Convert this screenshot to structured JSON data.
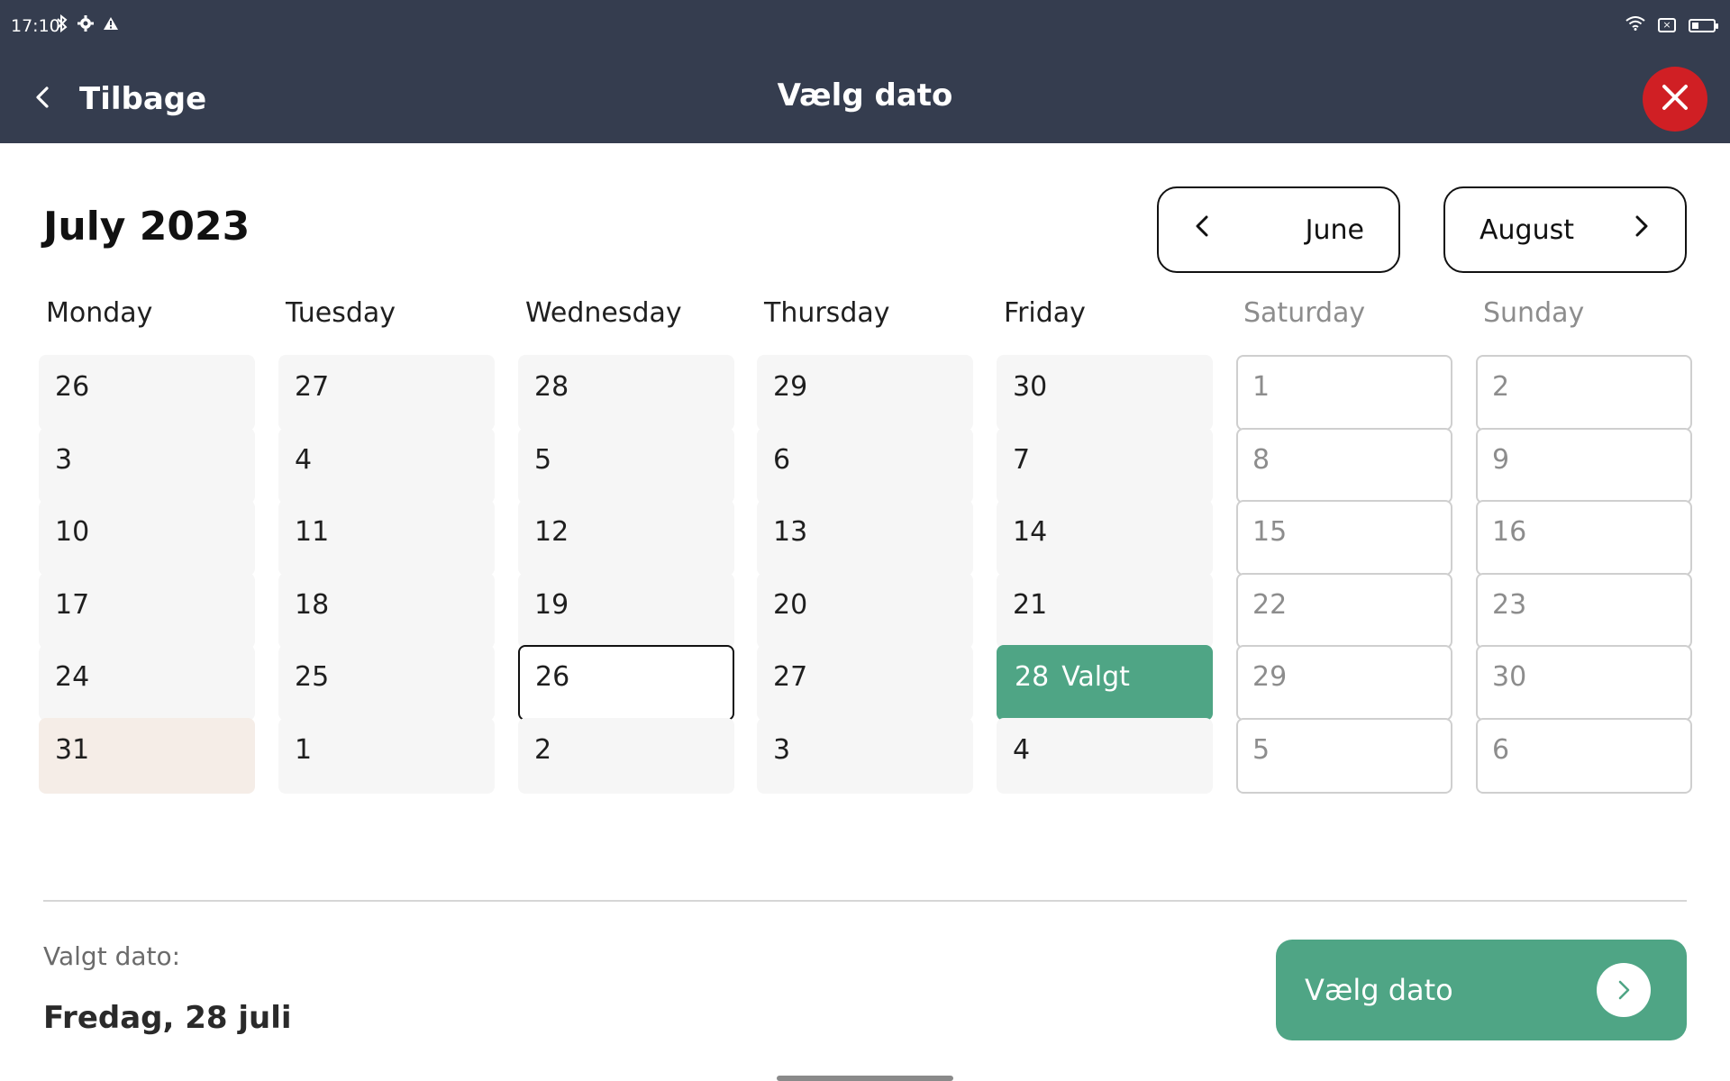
{
  "status_bar": {
    "time": "17:10",
    "icons_left": [
      "bluetooth-icon",
      "settings-icon",
      "warning-icon"
    ],
    "icons_right": [
      "wifi-icon",
      "no-sim-icon",
      "battery-icon"
    ]
  },
  "header": {
    "back_label": "Tilbage",
    "title": "Vælg dato",
    "close_icon": "close-icon"
  },
  "calendar": {
    "month_title": "July 2023",
    "prev_month_label": "June",
    "next_month_label": "August",
    "weekdays": [
      "Monday",
      "Tuesday",
      "Wednesday",
      "Thursday",
      "Friday",
      "Saturday",
      "Sunday"
    ],
    "weeks": [
      [
        "26",
        "27",
        "28",
        "29",
        "30",
        "1",
        "2"
      ],
      [
        "3",
        "4",
        "5",
        "6",
        "7",
        "8",
        "9"
      ],
      [
        "10",
        "11",
        "12",
        "13",
        "14",
        "15",
        "16"
      ],
      [
        "17",
        "18",
        "19",
        "20",
        "21",
        "22",
        "23"
      ],
      [
        "24",
        "25",
        "26",
        "27",
        "28",
        "29",
        "30"
      ],
      [
        "31",
        "1",
        "2",
        "3",
        "4",
        "5",
        "6"
      ]
    ],
    "selected_tag": "Valgt",
    "selected_day": "28",
    "today_day": "26",
    "highlighted_day": "31",
    "colors": {
      "selected": "#4fa585",
      "today_border": "#111111",
      "highlight": "#f5ede7",
      "weekday_cell": "#f6f6f6",
      "weekend_text": "#8d8d8d"
    }
  },
  "footer": {
    "selected_caption": "Valgt dato:",
    "selected_value": "Fredag, 28 juli",
    "confirm_label": "Vælg dato"
  }
}
